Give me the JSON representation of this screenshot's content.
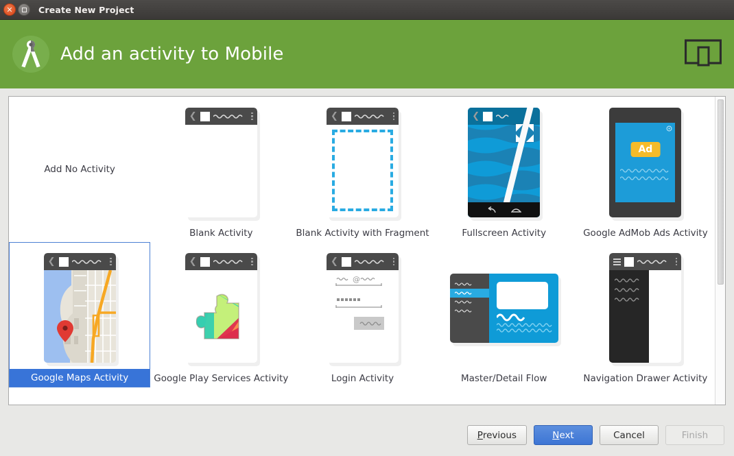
{
  "window": {
    "title": "Create New Project",
    "close_icon": "close-icon",
    "maximize_icon": "maximize-icon"
  },
  "header": {
    "title": "Add an activity to Mobile",
    "logo_icon": "android-studio-logo-icon",
    "device_icon": "tablet-device-icon",
    "background": "#6ca23c"
  },
  "gallery": {
    "selected_index": 4,
    "items": [
      {
        "label": "Add No Activity",
        "thumb": "none",
        "selected": false
      },
      {
        "label": "Blank Activity",
        "thumb": "blank",
        "selected": false
      },
      {
        "label": "Blank Activity with Fragment",
        "thumb": "fragment",
        "selected": false
      },
      {
        "label": "Fullscreen Activity",
        "thumb": "fullscreen",
        "selected": false
      },
      {
        "label": "Google AdMob Ads Activity",
        "thumb": "admob",
        "selected": false
      },
      {
        "label": "Google Maps Activity",
        "thumb": "maps",
        "selected": true
      },
      {
        "label": "Google Play Services Activity",
        "thumb": "playservices",
        "selected": false
      },
      {
        "label": "Login Activity",
        "thumb": "login",
        "selected": false
      },
      {
        "label": "Master/Detail Flow",
        "thumb": "masterdetail",
        "selected": false
      },
      {
        "label": "Navigation Drawer Activity",
        "thumb": "navdrawer",
        "selected": false
      }
    ],
    "admob_badge": "Ad",
    "selection_color": "#3874d8"
  },
  "footer": {
    "previous": {
      "mnemonic": "P",
      "rest": "revious"
    },
    "next": {
      "mnemonic": "N",
      "rest": "ext"
    },
    "cancel": "Cancel",
    "finish": "Finish",
    "finish_enabled": false
  }
}
